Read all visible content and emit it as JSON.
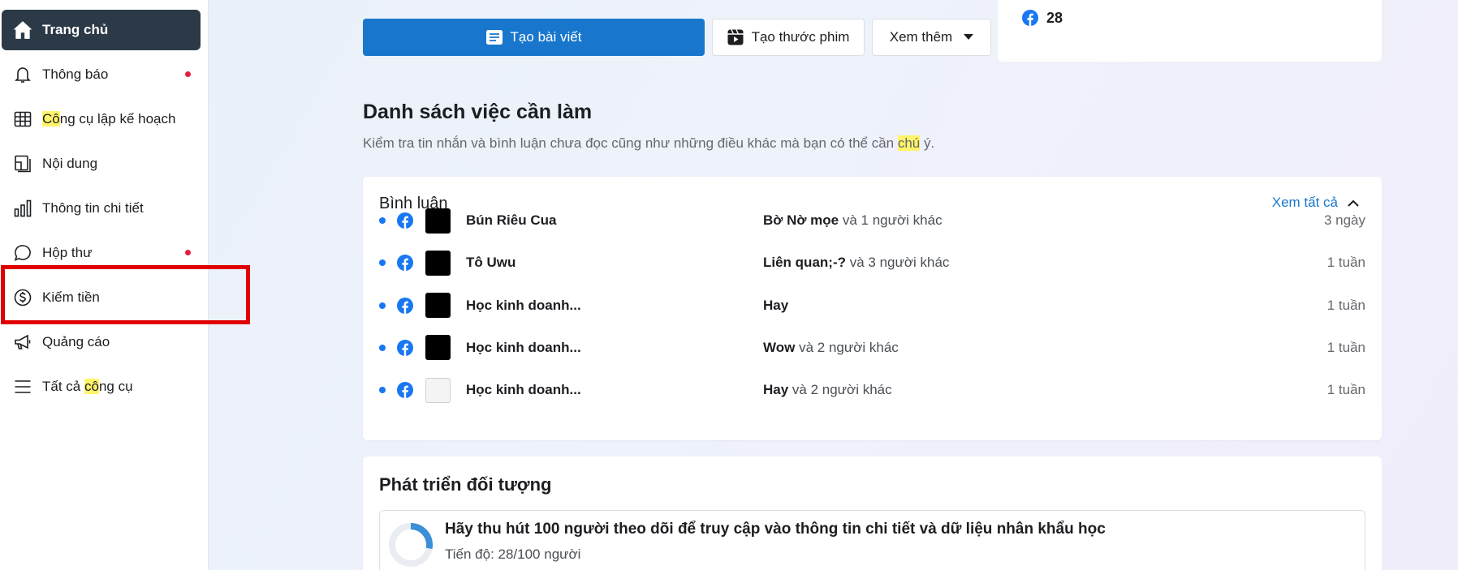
{
  "sidebar": {
    "items": [
      {
        "label": "Trang chủ",
        "icon": "home-icon",
        "active": true
      },
      {
        "label": "Thông báo",
        "icon": "bell-icon",
        "dot": true
      },
      {
        "label_hl": "Cô",
        "label_rest": "ng cụ lập kế hoạch",
        "icon": "calendar-grid-icon"
      },
      {
        "label": "Nội dung",
        "icon": "content-icon"
      },
      {
        "label": "Thông tin chi tiết",
        "icon": "bar-chart-icon"
      },
      {
        "label": "Hộp thư",
        "icon": "chat-bubble-icon",
        "dot": true
      },
      {
        "label": "Kiếm tiền",
        "icon": "dollar-circle-icon"
      },
      {
        "label": "Quảng cáo",
        "icon": "megaphone-icon"
      },
      {
        "label_pre": "Tất cả ",
        "label_hl": "cô",
        "label_rest": "ng cụ",
        "icon": "menu-lines-icon"
      }
    ]
  },
  "toolbar": {
    "create_post": "Tạo bài viết",
    "create_reel": "Tạo thước phim",
    "see_more": "Xem thêm"
  },
  "top_card": {
    "count": "28"
  },
  "todo": {
    "title": "Danh sách việc cần làm",
    "subtitle_pre": "Kiểm tra tin nhắn và bình luận chưa đọc cũng như những điều khác mà bạn có thể cần ",
    "subtitle_hl": "chú",
    "subtitle_post": " ý."
  },
  "comments": {
    "title": "Bình luận",
    "see_all": "Xem tất cả",
    "rows": [
      {
        "name": "Bún Riêu Cua",
        "who": "Bờ Nờ mọe",
        "others": " và 1 người khác",
        "time": "3 ngày",
        "thumb": "dark"
      },
      {
        "name": "Tô Uwu",
        "who": "Liên quan;-?",
        "others": " và 3 người khác",
        "time": "1 tuần",
        "thumb": "dark"
      },
      {
        "name": "Học kinh doanh...",
        "who": "Hay",
        "others": "",
        "time": "1 tuần",
        "thumb": "dark"
      },
      {
        "name": "Học kinh doanh...",
        "who": "Wow",
        "others": " và 2 người khác",
        "time": "1 tuần",
        "thumb": "dark"
      },
      {
        "name": "Học kinh doanh...",
        "who": "Hay",
        "others": " và 2 người khác",
        "time": "1 tuần",
        "thumb": "light"
      }
    ]
  },
  "audience": {
    "title": "Phát triển đối tượng",
    "goal": "Hãy thu hút 100 người theo dõi để truy cập vào thông tin chi tiết và dữ liệu nhân khẩu học",
    "progress_label": "Tiến độ: 28/100 người",
    "progress_fraction": 0.28
  },
  "colors": {
    "accent": "#1877cc",
    "active_bg": "#2c3a47",
    "highlight": "#fff46a",
    "annotation_red": "#e00000"
  }
}
